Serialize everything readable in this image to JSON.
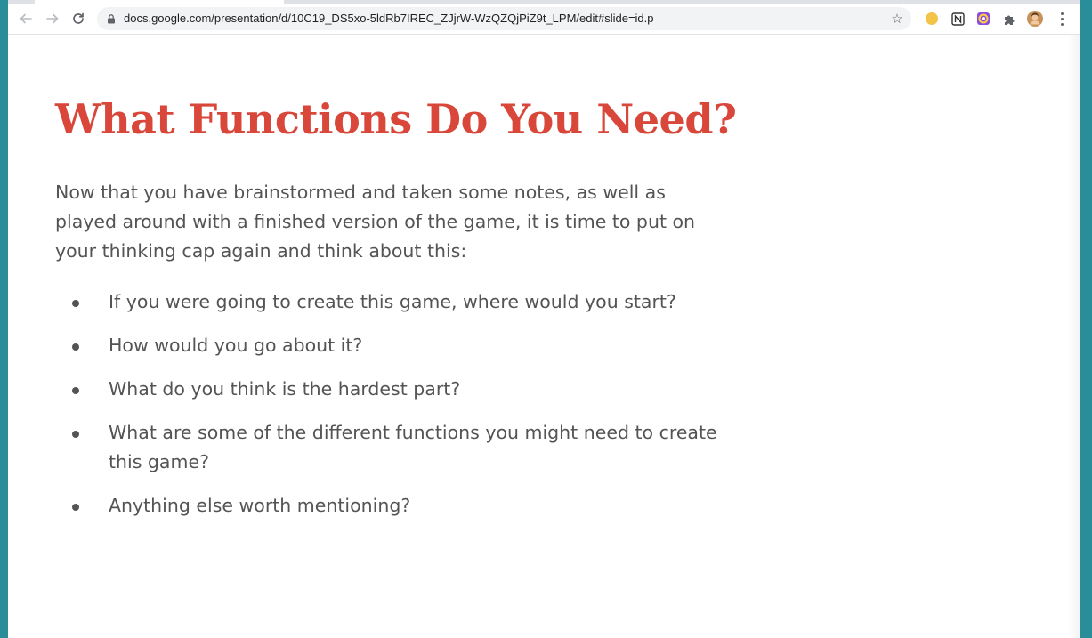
{
  "browser": {
    "url": "docs.google.com/presentation/d/10C19_DS5xo-5ldRb7IREC_ZJjrW-WzQZQjPiZ9t_LPM/edit#slide=id.p"
  },
  "slide": {
    "title": "What Functions Do You Need?",
    "intro": "Now that you have brainstormed and taken some notes, as well as played around with a finished version of the game, it is time to put on your thinking cap again and think about this:",
    "bullets": [
      "If you were going to create this game, where would you start?",
      "How would you go about it?",
      "What do you think is the hardest part?",
      "What are some of the different functions you might need to create this game?",
      "Anything else worth mentioning?"
    ]
  },
  "colors": {
    "title": "#d9463a",
    "body_text": "#545454",
    "frame": "#2a8d9a"
  },
  "icons": [
    "back-arrow-icon",
    "forward-arrow-icon",
    "reload-icon",
    "lock-icon",
    "star-icon",
    "extension-icon",
    "puzzle-icon",
    "avatar",
    "menu-icon"
  ]
}
